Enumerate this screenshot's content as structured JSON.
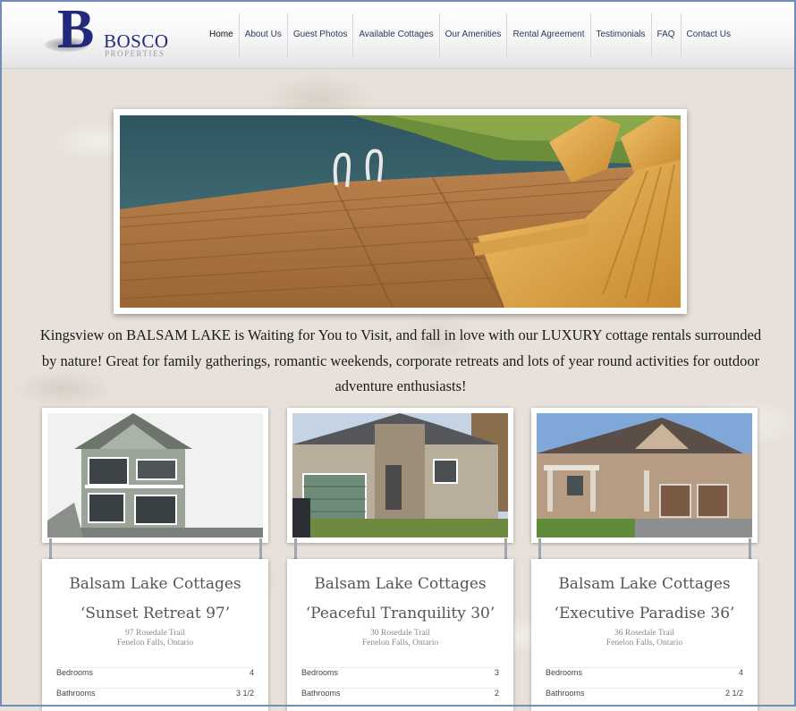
{
  "logo": {
    "letter": "B",
    "name": "BOSCO",
    "sub": "PROPERTIES"
  },
  "nav": [
    "Home",
    "About Us",
    "Guest Photos",
    "Available Cottages",
    "Our Amenities",
    "Rental Agreement",
    "Testimonials",
    "FAQ",
    "Contact Us"
  ],
  "intro": "Kingsview on BALSAM LAKE is Waiting for You to Visit, and fall in love with our LUXURY  cottage rentals surrounded by nature!  Great for family gatherings, romantic weekends, corporate retreats and lots of year round activities for outdoor adventure enthusiasts!",
  "cottages": [
    {
      "title": "Balsam Lake Cottages",
      "name": "‘Sunset Retreat 97’",
      "address1": "97 Rosedale Trail",
      "address2": "Fenelon Falls, Ontario",
      "bedrooms_label": "Bedrooms",
      "bedrooms": "4",
      "bathrooms_label": "Bathrooms",
      "bathrooms": "3 1/2"
    },
    {
      "title": "Balsam Lake Cottages",
      "name": "‘Peaceful Tranquility 30’",
      "address1": "30 Rosedale Trail",
      "address2": "Fenelon Falls, Ontario",
      "bedrooms_label": "Bedrooms",
      "bedrooms": "3",
      "bathrooms_label": "Bathrooms",
      "bathrooms": "2"
    },
    {
      "title": "Balsam Lake Cottages",
      "name": "‘Executive Paradise 36’",
      "address1": "36 Rosedale Trail",
      "address2": "Fenelon Falls, Ontario",
      "bedrooms_label": "Bedrooms",
      "bedrooms": "4",
      "bathrooms_label": "Bathrooms",
      "bathrooms": "2 1/2"
    }
  ]
}
